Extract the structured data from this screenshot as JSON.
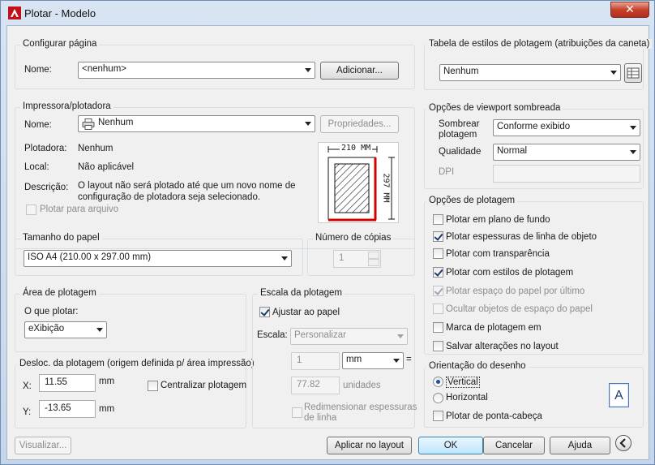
{
  "window": {
    "title": "Plotar - Modelo",
    "close_glyph": "✕"
  },
  "page_setup": {
    "legend": "Configurar página",
    "name_label": "Nome:",
    "name_value": "<nenhum>",
    "add_button": "Adicionar..."
  },
  "plotter": {
    "legend": "Impressora/plotadora",
    "name_label": "Nome:",
    "name_value": "Nenhum",
    "properties_button": "Propriedades...",
    "plotter_label": "Plotadora:",
    "plotter_value": "Nenhum",
    "location_label": "Local:",
    "location_value": "Não aplicável",
    "description_label": "Descrição:",
    "description_line1": "O layout não será plotado até que um novo nome de",
    "description_line2": "configuração de plotadora seja selecionado.",
    "plot_to_file": "Plotar para arquivo",
    "preview_width": "210 MM",
    "preview_height": "297 MM"
  },
  "paper_size": {
    "legend": "Tamanho do papel",
    "value": "ISO A4 (210.00 x 297.00 mm)"
  },
  "copies": {
    "legend": "Número de cópias",
    "value": "1"
  },
  "plot_area": {
    "legend": "Área de plotagem",
    "what_label": "O que plotar:",
    "what_value": "eXibição"
  },
  "plot_offset": {
    "legend": "Desloc. da plotagem (origem definida p/ área impressão)",
    "x_label": "X:",
    "x_value": "11.55",
    "y_label": "Y:",
    "y_value": "-13.65",
    "unit": "mm",
    "center": "Centralizar plotagem"
  },
  "plot_scale": {
    "legend": "Escala da plotagem",
    "fit": "Ajustar ao papel",
    "scale_label": "Escala:",
    "scale_value": "Personalizar",
    "val1": "1",
    "unit1": "mm",
    "equals": "=",
    "val2": "77.82",
    "unit2": "unidades",
    "lineweights_line1": "Redimensionar espessuras",
    "lineweights_line2": "de linha"
  },
  "style_table": {
    "legend": "Tabela de estilos de plotagem (atribuições da caneta)",
    "value": "Nenhum"
  },
  "shaded": {
    "legend": "Opções de viewport sombreada",
    "shade_label1": "Sombrear",
    "shade_label2": "plotagem",
    "shade_value": "Conforme exibido",
    "quality_label": "Qualidade",
    "quality_value": "Normal",
    "dpi_label": "DPI"
  },
  "plot_options": {
    "legend": "Opções de plotagem",
    "background": "Plotar em plano de fundo",
    "lineweights": "Plotar espessuras de linha de objeto",
    "transparency": "Plotar com transparência",
    "styles": "Plotar com estilos de plotagem",
    "paperspace_last": "Plotar espaço do papel por último",
    "hide_objects": "Ocultar objetos de espaço do papel",
    "stamp": "Marca de plotagem em",
    "save_changes": "Salvar alterações no layout"
  },
  "orientation": {
    "legend": "Orientação do desenho",
    "portrait": "Vertical",
    "landscape": "Horizontal",
    "upside_down": "Plotar de ponta-cabeça",
    "icon_letter": "A"
  },
  "footer": {
    "preview": "Visualizar...",
    "apply": "Aplicar no layout",
    "ok": "OK",
    "cancel": "Cancelar",
    "help": "Ajuda"
  }
}
